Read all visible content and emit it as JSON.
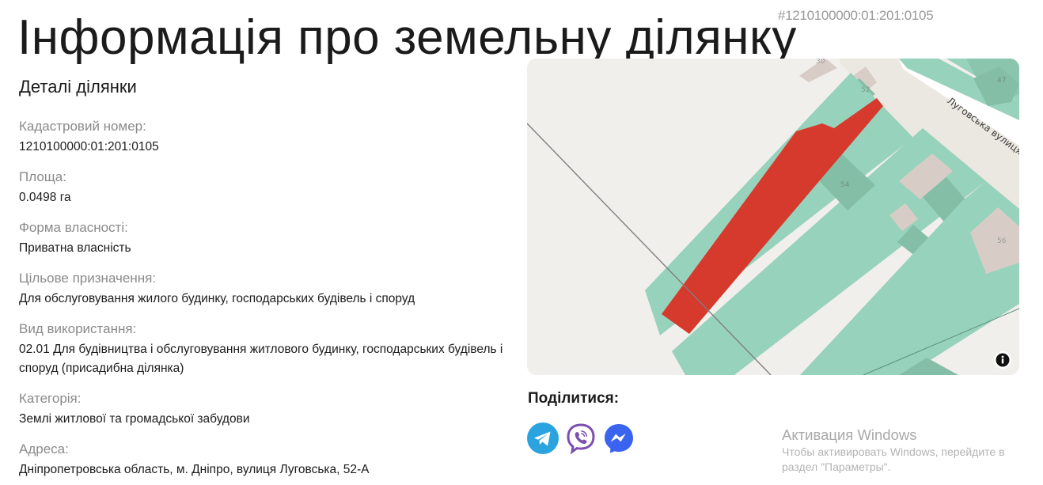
{
  "header": {
    "title": "Інформація про земельну ділянку",
    "cadastral_tag": "#1210100000:01:201:0105"
  },
  "details": {
    "heading": "Деталі ділянки",
    "fields": [
      {
        "label": "Кадастровий номер:",
        "value": "1210100000:01:201:0105"
      },
      {
        "label": "Площа:",
        "value": "0.0498 га"
      },
      {
        "label": "Форма власності:",
        "value": "Приватна власність"
      },
      {
        "label": "Цільове призначення:",
        "value": "Для обслуговування жилого будинку, господарських будівель і споруд"
      },
      {
        "label": "Вид використання:",
        "value": "02.01 Для будівництва і обслуговування житлового будинку, господарських будівель і споруд (присадибна ділянка)"
      },
      {
        "label": "Категорія:",
        "value": "Землі житлової та громадської забудови"
      },
      {
        "label": "Адреса:",
        "value": "Дніпропетровська область, м. Дніпро, вулиця Луговська, 52-А"
      }
    ]
  },
  "map": {
    "street_label": "Луговська вулиця",
    "house_numbers": [
      "30",
      "52",
      "47",
      "54",
      "56"
    ],
    "colors": {
      "background": "#f1efeb",
      "parcel": "#97d2bd",
      "selected_parcel": "#d63a2c",
      "building": "#d8cdc6",
      "road": "#ffffff"
    },
    "info_icon": "info-icon"
  },
  "share": {
    "heading": "Поділитися:",
    "buttons": [
      {
        "name": "telegram",
        "icon": "telegram-icon",
        "color": "#2aa3df"
      },
      {
        "name": "viber",
        "icon": "viber-icon",
        "color": "#7d4fb0"
      },
      {
        "name": "messenger",
        "icon": "messenger-icon",
        "color": "#3a63f0"
      }
    ]
  },
  "watermark": {
    "title": "Активация Windows",
    "subtitle": "Чтобы активировать Windows, перейдите в раздел \"Параметры\"."
  }
}
